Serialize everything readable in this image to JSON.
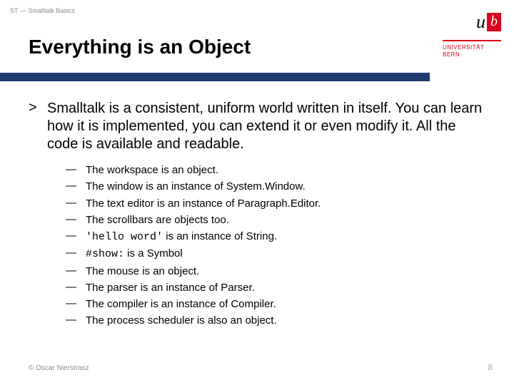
{
  "header": {
    "breadcrumb": "ST — Smalltalk Basics"
  },
  "title": "Everything is an Object",
  "logo": {
    "u": "u",
    "b": "b",
    "line1": "UNIVERSITÄT",
    "line2": "BERN"
  },
  "main": {
    "marker": ">",
    "text": "Smalltalk is a consistent, uniform world written in itself. You can learn how it is implemented, you can extend it or even modify it. All the code is available and readable."
  },
  "sub_marker": "—",
  "items": [
    {
      "plain": "The workspace is an object."
    },
    {
      "plain": "The window is an instance of System.Window."
    },
    {
      "plain": "The text editor is an instance of Paragraph.Editor."
    },
    {
      "plain": "The scrollbars are objects too."
    },
    {
      "code": "'hello word'",
      "rest": " is an instance of String."
    },
    {
      "code": "#show:",
      "rest": " is a Symbol"
    },
    {
      "plain": "The mouse is an object."
    },
    {
      "plain": "The parser is an instance of Parser."
    },
    {
      "plain": "The compiler is an instance of Compiler."
    },
    {
      "plain": "The process scheduler is also an object."
    }
  ],
  "footer": {
    "copyright": "© Oscar Nierstrasz",
    "page": "8"
  }
}
